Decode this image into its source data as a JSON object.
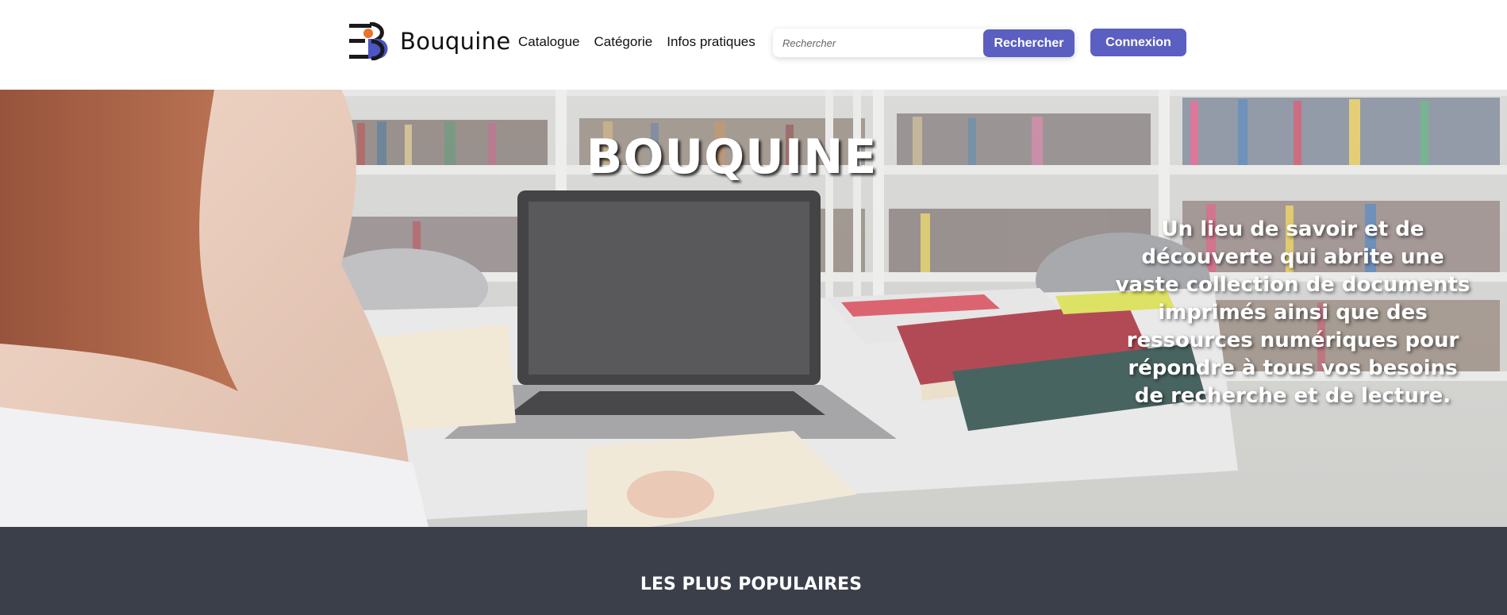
{
  "brand": {
    "name": "Bouquine"
  },
  "nav": {
    "items": [
      {
        "label": "Catalogue"
      },
      {
        "label": "Catégorie"
      },
      {
        "label": "Infos pratiques"
      }
    ]
  },
  "search": {
    "placeholder": "Rechercher",
    "value": "",
    "button_label": "Rechercher"
  },
  "auth": {
    "login_label": "Connexion"
  },
  "hero": {
    "title": "BOUQUINE",
    "description": "Un lieu de savoir et de découverte qui abrite une vaste collection de documents imprimés ainsi que des ressources numériques pour répondre à tous vos besoins de recherche et de lecture."
  },
  "popular": {
    "title": "LES PLUS POPULAIRES"
  },
  "colors": {
    "accent": "#5b5fc1",
    "logo_orange": "#e8742c",
    "logo_blue": "#4b55c4",
    "dark_band": "#3b3f4a"
  }
}
